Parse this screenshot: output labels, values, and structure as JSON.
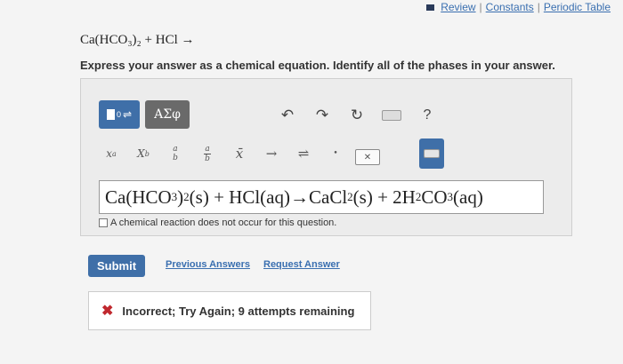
{
  "header": {
    "review": "Review",
    "constants": "Constants",
    "periodic_table": "Periodic Table",
    "separator": "|"
  },
  "question": {
    "equation_text": "Ca(HCO₃)₂ + HCl →",
    "instruction": "Express your answer as a chemical equation. Identify all of the phases in your answer."
  },
  "toolbar": {
    "greek_label": "ΑΣφ",
    "template_sup": "0",
    "help_label": "?",
    "undo_icon": "↶",
    "redo_icon": "↷",
    "reset_icon": "↻"
  },
  "keys": {
    "superscript": "x",
    "superscript_sup": "a",
    "subscript": "X",
    "subscript_sub": "b",
    "frac_a": "a",
    "frac_b": "b",
    "mixed_a": "a",
    "mixed_b": "b",
    "mean": "x̄",
    "arrow": "→",
    "equilibrium": "⇌",
    "dot": "•",
    "delete": "✕"
  },
  "answer": {
    "p1": "Ca(HCO",
    "s1": "3",
    "p2": ")",
    "s2": "2",
    "p3": "(s) + HCl(aq)→CaCl",
    "s3": "2",
    "p4": "(s) + 2H",
    "s4": "2",
    "p5": "CO",
    "s5": "3",
    "p6": "(aq)"
  },
  "options": {
    "no_reaction": "A chemical reaction does not occur for this question."
  },
  "actions": {
    "submit": "Submit",
    "previous_answers": "Previous Answers",
    "request_answer": "Request Answer"
  },
  "feedback": {
    "icon": "✖",
    "message": "Incorrect; Try Again; 9 attempts remaining"
  },
  "colors": {
    "accent": "#3f6fa8",
    "error": "#c0282e",
    "link": "#3a6fb0"
  }
}
